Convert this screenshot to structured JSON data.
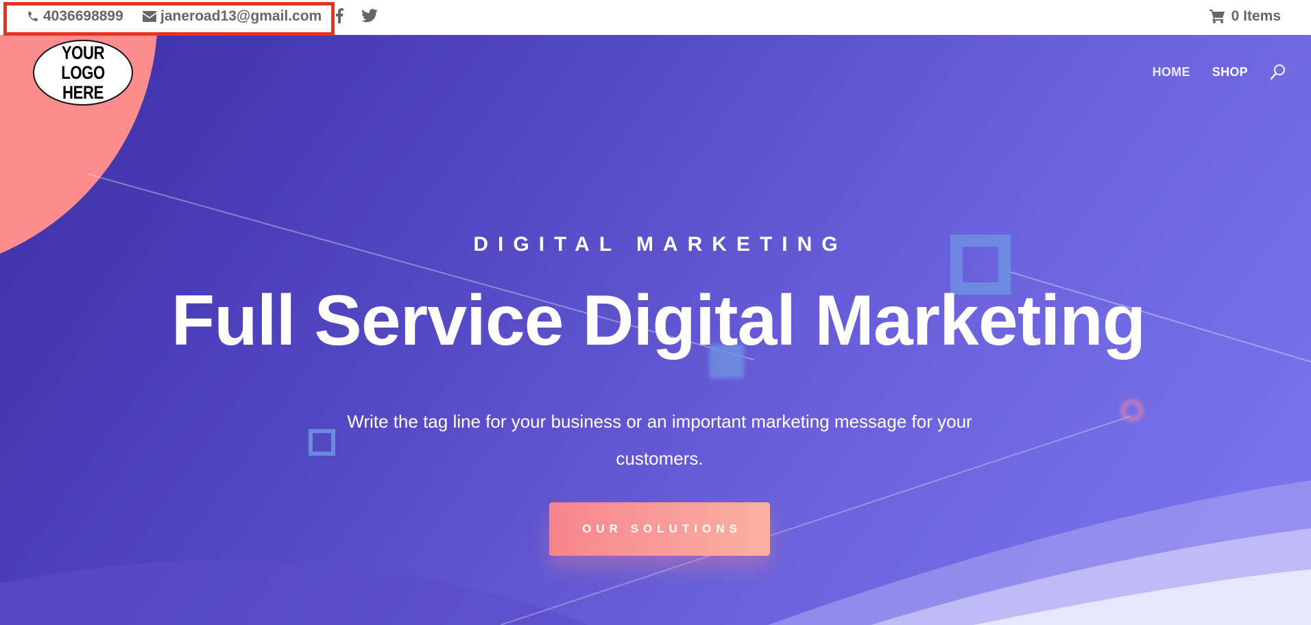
{
  "topbar": {
    "phone": "4036698899",
    "email": "janeroad13@gmail.com",
    "social": [
      "facebook-icon",
      "twitter-icon"
    ],
    "cart_label": "0 Items"
  },
  "logo": {
    "text": "YOUR\nLOGO HERE"
  },
  "nav": {
    "items": [
      {
        "label": "HOME"
      },
      {
        "label": "SHOP"
      }
    ],
    "search_icon": "search-icon"
  },
  "hero": {
    "eyebrow": "DIGITAL MARKETING",
    "headline": "Full Service Digital Marketing",
    "tagline": "Write the tag line for your business or an important marketing message for your customers.",
    "cta_label": "OUR SOLUTIONS"
  },
  "colors": {
    "highlight_border": "#e8321f",
    "hero_start": "#3c2fa6",
    "hero_end": "#7c78ee",
    "accent_coral": "#fd8c8c",
    "cta_start": "#f7848e",
    "cta_end": "#fbb1a2"
  }
}
